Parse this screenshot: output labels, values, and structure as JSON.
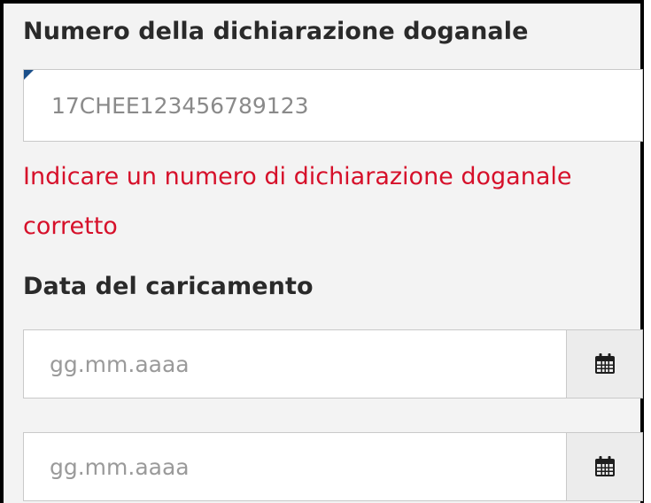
{
  "declaration": {
    "label": "Numero della dichiarazione doganale",
    "value": "17CHEE123456789123",
    "error": "Indicare un numero di dichiarazione doganale corretto"
  },
  "loading_date": {
    "label": "Data del caricamento",
    "date_from": {
      "placeholder": "gg.mm.aaaa",
      "button_icon": "calendar-icon"
    },
    "date_to": {
      "placeholder": "gg.mm.aaaa",
      "button_icon": "calendar-icon"
    }
  },
  "colors": {
    "error": "#d6102a",
    "panel_background": "#f3f3f3",
    "field_border": "#c9c9c9",
    "corner_marker": "#1a4f8a"
  }
}
